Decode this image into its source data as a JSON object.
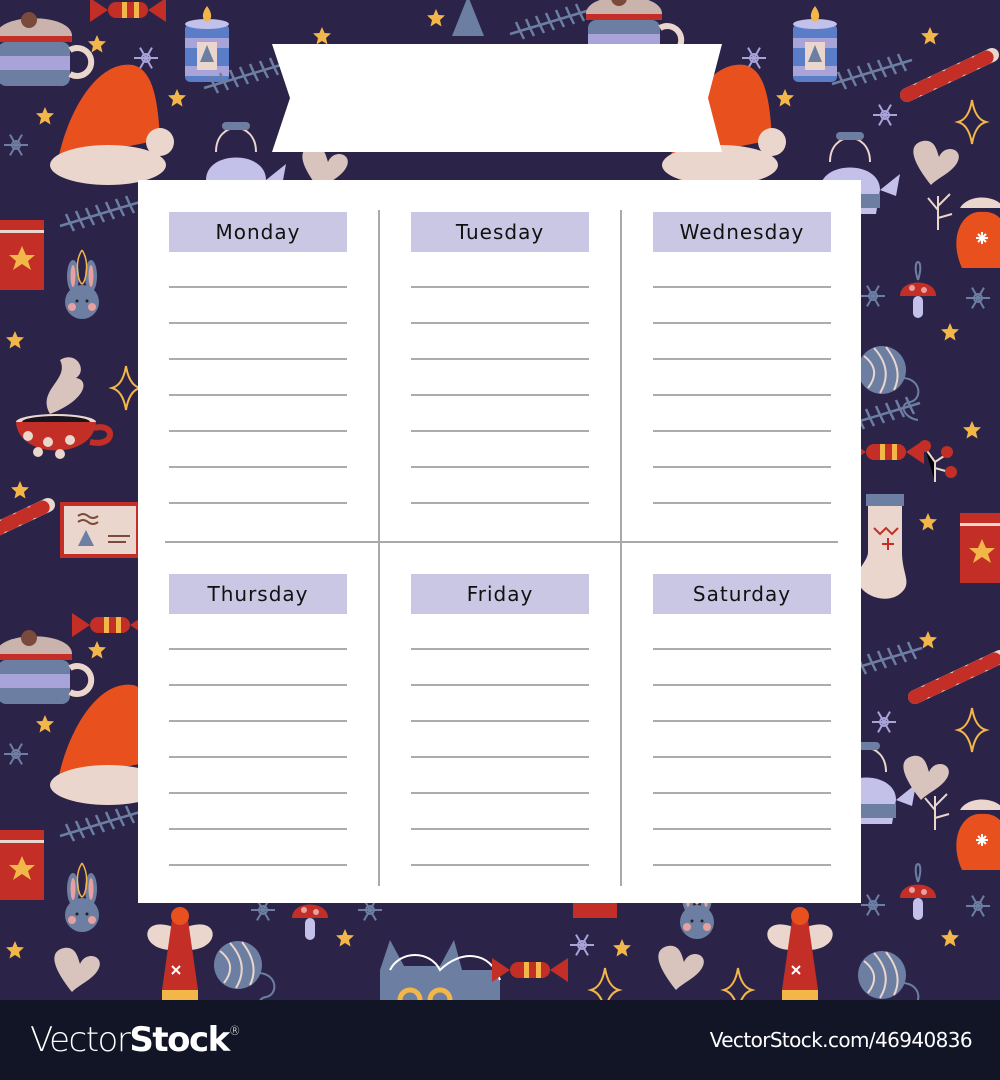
{
  "planner": {
    "title_banner": "",
    "days": [
      {
        "label": "Monday"
      },
      {
        "label": "Tuesday"
      },
      {
        "label": "Wednesday"
      },
      {
        "label": "Thursday"
      },
      {
        "label": "Friday"
      },
      {
        "label": "Saturday"
      }
    ],
    "lines_per_day": 7
  },
  "background": {
    "theme": "christmas-pattern",
    "colors": {
      "navy": "#2b2448",
      "red": "#c32f27",
      "orange": "#e8501e",
      "cream": "#ead6cc",
      "lavender": "#a8a4da",
      "slate": "#6c7fa3",
      "gold": "#f3b648"
    },
    "motifs": [
      "gingerbread-cocoa-mug-icon",
      "candy-icon",
      "candle-icon",
      "snowflake-icon",
      "star-icon",
      "santa-hat-icon",
      "pine-branch-icon",
      "gift-box-icon",
      "bunny-ornament-icon",
      "coffee-cup-icon",
      "sparkle-icon",
      "envelope-icon",
      "candy-cane-icon",
      "teapot-icon",
      "mitten-icon",
      "mushroom-ornament-icon",
      "yarn-ball-icon",
      "berries-icon",
      "stocking-icon",
      "angel-icon",
      "cat-icon",
      "tree-icon"
    ]
  },
  "footer": {
    "logo_light": "Vector",
    "logo_bold": "Stock",
    "logo_mark": "®",
    "url": "VectorStock.com/46940836"
  }
}
